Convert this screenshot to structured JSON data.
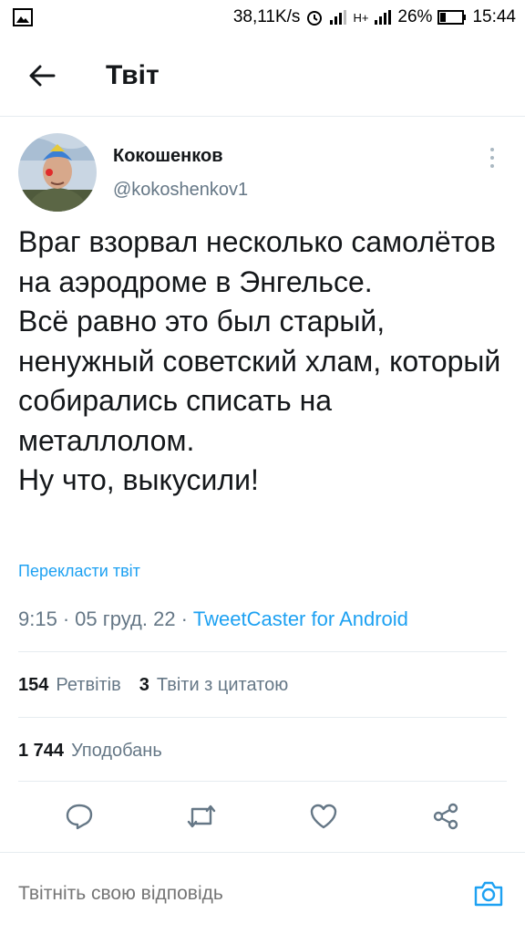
{
  "status_bar": {
    "net_speed": "38,11K/s",
    "network": "H+",
    "battery": "26%",
    "time": "15:44"
  },
  "header": {
    "title": "Твіт"
  },
  "tweet": {
    "display_name": "Кокошенков",
    "handle": "@kokoshenkov1",
    "text": "Враг взорвал несколько самолётов на аэродроме в Энгельсе.\nВсё равно это был старый, ненужный советский хлам, который собирались списать на металлолом.\nНу что, выкусили!",
    "translate_label": "Перекласти твіт",
    "time": "9:15",
    "date": "05 груд. 22",
    "client": "TweetCaster for Android",
    "separator": "·"
  },
  "stats": {
    "retweets_count": "154",
    "retweets_label": "Ретвітів",
    "quotes_count": "3",
    "quotes_label": "Твіти з цитатою",
    "likes_count": "1 744",
    "likes_label": "Уподобань"
  },
  "reply": {
    "placeholder": "Твітніть свою відповідь"
  },
  "colors": {
    "accent": "#1da1f2",
    "muted": "#657786",
    "text": "#14171a",
    "divider": "#e6ecf0"
  },
  "icons": [
    "image-icon",
    "alarm-icon",
    "signal-icon",
    "battery-icon",
    "back-arrow-icon",
    "more-vertical-icon",
    "reply-icon",
    "retweet-icon",
    "like-icon",
    "share-icon",
    "camera-icon"
  ]
}
